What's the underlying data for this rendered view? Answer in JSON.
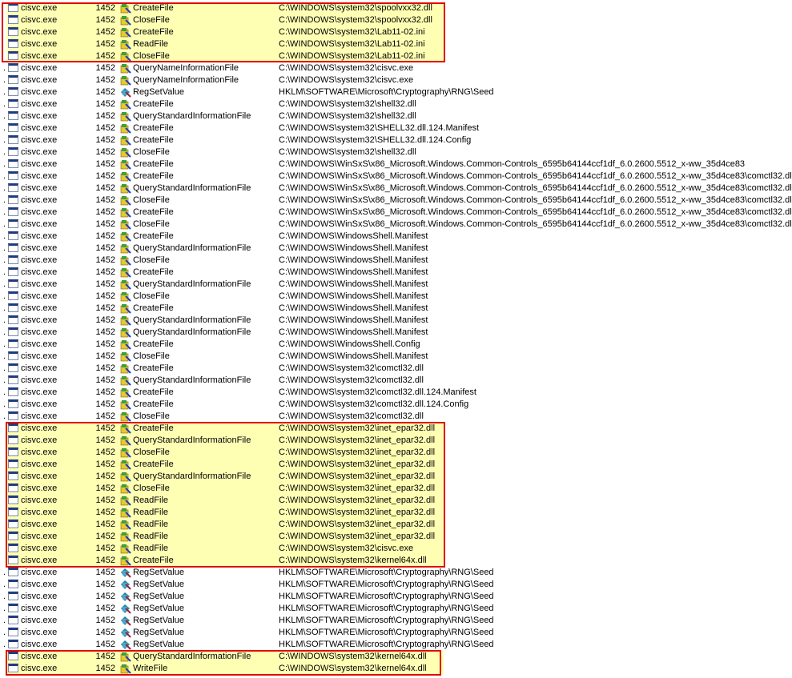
{
  "colors": {
    "highlight": "#ffffb4",
    "box": "#e00000"
  },
  "process": "cisvc.exe",
  "pid": "1452",
  "rows": [
    {
      "op": "CreateFile",
      "path": "C:\\WINDOWS\\system32\\spoolvxx32.dll",
      "hl": true
    },
    {
      "op": "CloseFile",
      "path": "C:\\WINDOWS\\system32\\spoolvxx32.dll",
      "hl": true
    },
    {
      "op": "CreateFile",
      "path": "C:\\WINDOWS\\system32\\Lab11-02.ini",
      "hl": true
    },
    {
      "op": "ReadFile",
      "path": "C:\\WINDOWS\\system32\\Lab11-02.ini",
      "hl": true
    },
    {
      "op": "CloseFile",
      "path": "C:\\WINDOWS\\system32\\Lab11-02.ini",
      "hl": true
    },
    {
      "op": "QueryNameInformationFile",
      "path": "C:\\WINDOWS\\system32\\cisvc.exe"
    },
    {
      "op": "QueryNameInformationFile",
      "path": "C:\\WINDOWS\\system32\\cisvc.exe"
    },
    {
      "op": "RegSetValue",
      "path": "HKLM\\SOFTWARE\\Microsoft\\Cryptography\\RNG\\Seed",
      "reg": true
    },
    {
      "op": "CreateFile",
      "path": "C:\\WINDOWS\\system32\\shell32.dll"
    },
    {
      "op": "QueryStandardInformationFile",
      "path": "C:\\WINDOWS\\system32\\shell32.dll"
    },
    {
      "op": "CreateFile",
      "path": "C:\\WINDOWS\\system32\\SHELL32.dll.124.Manifest"
    },
    {
      "op": "CreateFile",
      "path": "C:\\WINDOWS\\system32\\SHELL32.dll.124.Config"
    },
    {
      "op": "CloseFile",
      "path": "C:\\WINDOWS\\system32\\shell32.dll"
    },
    {
      "op": "CreateFile",
      "path": "C:\\WINDOWS\\WinSxS\\x86_Microsoft.Windows.Common-Controls_6595b64144ccf1df_6.0.2600.5512_x-ww_35d4ce83"
    },
    {
      "op": "CreateFile",
      "path": "C:\\WINDOWS\\WinSxS\\x86_Microsoft.Windows.Common-Controls_6595b64144ccf1df_6.0.2600.5512_x-ww_35d4ce83\\comctl32.dll"
    },
    {
      "op": "QueryStandardInformationFile",
      "path": "C:\\WINDOWS\\WinSxS\\x86_Microsoft.Windows.Common-Controls_6595b64144ccf1df_6.0.2600.5512_x-ww_35d4ce83\\comctl32.dll"
    },
    {
      "op": "CloseFile",
      "path": "C:\\WINDOWS\\WinSxS\\x86_Microsoft.Windows.Common-Controls_6595b64144ccf1df_6.0.2600.5512_x-ww_35d4ce83\\comctl32.dll"
    },
    {
      "op": "CreateFile",
      "path": "C:\\WINDOWS\\WinSxS\\x86_Microsoft.Windows.Common-Controls_6595b64144ccf1df_6.0.2600.5512_x-ww_35d4ce83\\comctl32.dll"
    },
    {
      "op": "CloseFile",
      "path": "C:\\WINDOWS\\WinSxS\\x86_Microsoft.Windows.Common-Controls_6595b64144ccf1df_6.0.2600.5512_x-ww_35d4ce83\\comctl32.dll"
    },
    {
      "op": "CreateFile",
      "path": "C:\\WINDOWS\\WindowsShell.Manifest"
    },
    {
      "op": "QueryStandardInformationFile",
      "path": "C:\\WINDOWS\\WindowsShell.Manifest"
    },
    {
      "op": "CloseFile",
      "path": "C:\\WINDOWS\\WindowsShell.Manifest"
    },
    {
      "op": "CreateFile",
      "path": "C:\\WINDOWS\\WindowsShell.Manifest"
    },
    {
      "op": "QueryStandardInformationFile",
      "path": "C:\\WINDOWS\\WindowsShell.Manifest"
    },
    {
      "op": "CloseFile",
      "path": "C:\\WINDOWS\\WindowsShell.Manifest"
    },
    {
      "op": "CreateFile",
      "path": "C:\\WINDOWS\\WindowsShell.Manifest"
    },
    {
      "op": "QueryStandardInformationFile",
      "path": "C:\\WINDOWS\\WindowsShell.Manifest"
    },
    {
      "op": "QueryStandardInformationFile",
      "path": "C:\\WINDOWS\\WindowsShell.Manifest"
    },
    {
      "op": "CreateFile",
      "path": "C:\\WINDOWS\\WindowsShell.Config"
    },
    {
      "op": "CloseFile",
      "path": "C:\\WINDOWS\\WindowsShell.Manifest"
    },
    {
      "op": "CreateFile",
      "path": "C:\\WINDOWS\\system32\\comctl32.dll"
    },
    {
      "op": "QueryStandardInformationFile",
      "path": "C:\\WINDOWS\\system32\\comctl32.dll"
    },
    {
      "op": "CreateFile",
      "path": "C:\\WINDOWS\\system32\\comctl32.dll.124.Manifest"
    },
    {
      "op": "CreateFile",
      "path": "C:\\WINDOWS\\system32\\comctl32.dll.124.Config"
    },
    {
      "op": "CloseFile",
      "path": "C:\\WINDOWS\\system32\\comctl32.dll"
    },
    {
      "op": "CreateFile",
      "path": "C:\\WINDOWS\\system32\\inet_epar32.dll",
      "hl": true
    },
    {
      "op": "QueryStandardInformationFile",
      "path": "C:\\WINDOWS\\system32\\inet_epar32.dll",
      "hl": true
    },
    {
      "op": "CloseFile",
      "path": "C:\\WINDOWS\\system32\\inet_epar32.dll",
      "hl": true
    },
    {
      "op": "CreateFile",
      "path": "C:\\WINDOWS\\system32\\inet_epar32.dll",
      "hl": true
    },
    {
      "op": "QueryStandardInformationFile",
      "path": "C:\\WINDOWS\\system32\\inet_epar32.dll",
      "hl": true
    },
    {
      "op": "CloseFile",
      "path": "C:\\WINDOWS\\system32\\inet_epar32.dll",
      "hl": true
    },
    {
      "op": "ReadFile",
      "path": "C:\\WINDOWS\\system32\\inet_epar32.dll",
      "hl": true
    },
    {
      "op": "ReadFile",
      "path": "C:\\WINDOWS\\system32\\inet_epar32.dll",
      "hl": true
    },
    {
      "op": "ReadFile",
      "path": "C:\\WINDOWS\\system32\\inet_epar32.dll",
      "hl": true
    },
    {
      "op": "ReadFile",
      "path": "C:\\WINDOWS\\system32\\inet_epar32.dll",
      "hl": true
    },
    {
      "op": "ReadFile",
      "path": "C:\\WINDOWS\\system32\\cisvc.exe",
      "hl": true
    },
    {
      "op": "CreateFile",
      "path": "C:\\WINDOWS\\system32\\kernel64x.dll",
      "hl": true
    },
    {
      "op": "RegSetValue",
      "path": "HKLM\\SOFTWARE\\Microsoft\\Cryptography\\RNG\\Seed",
      "reg": true
    },
    {
      "op": "RegSetValue",
      "path": "HKLM\\SOFTWARE\\Microsoft\\Cryptography\\RNG\\Seed",
      "reg": true
    },
    {
      "op": "RegSetValue",
      "path": "HKLM\\SOFTWARE\\Microsoft\\Cryptography\\RNG\\Seed",
      "reg": true
    },
    {
      "op": "RegSetValue",
      "path": "HKLM\\SOFTWARE\\Microsoft\\Cryptography\\RNG\\Seed",
      "reg": true
    },
    {
      "op": "RegSetValue",
      "path": "HKLM\\SOFTWARE\\Microsoft\\Cryptography\\RNG\\Seed",
      "reg": true
    },
    {
      "op": "RegSetValue",
      "path": "HKLM\\SOFTWARE\\Microsoft\\Cryptography\\RNG\\Seed",
      "reg": true
    },
    {
      "op": "RegSetValue",
      "path": "HKLM\\SOFTWARE\\Microsoft\\Cryptography\\RNG\\Seed",
      "reg": true
    },
    {
      "op": "QueryStandardInformationFile",
      "path": "C:\\WINDOWS\\system32\\kernel64x.dll",
      "hl": true
    },
    {
      "op": "WriteFile",
      "path": "C:\\WINDOWS\\system32\\kernel64x.dll",
      "hl": true
    }
  ]
}
